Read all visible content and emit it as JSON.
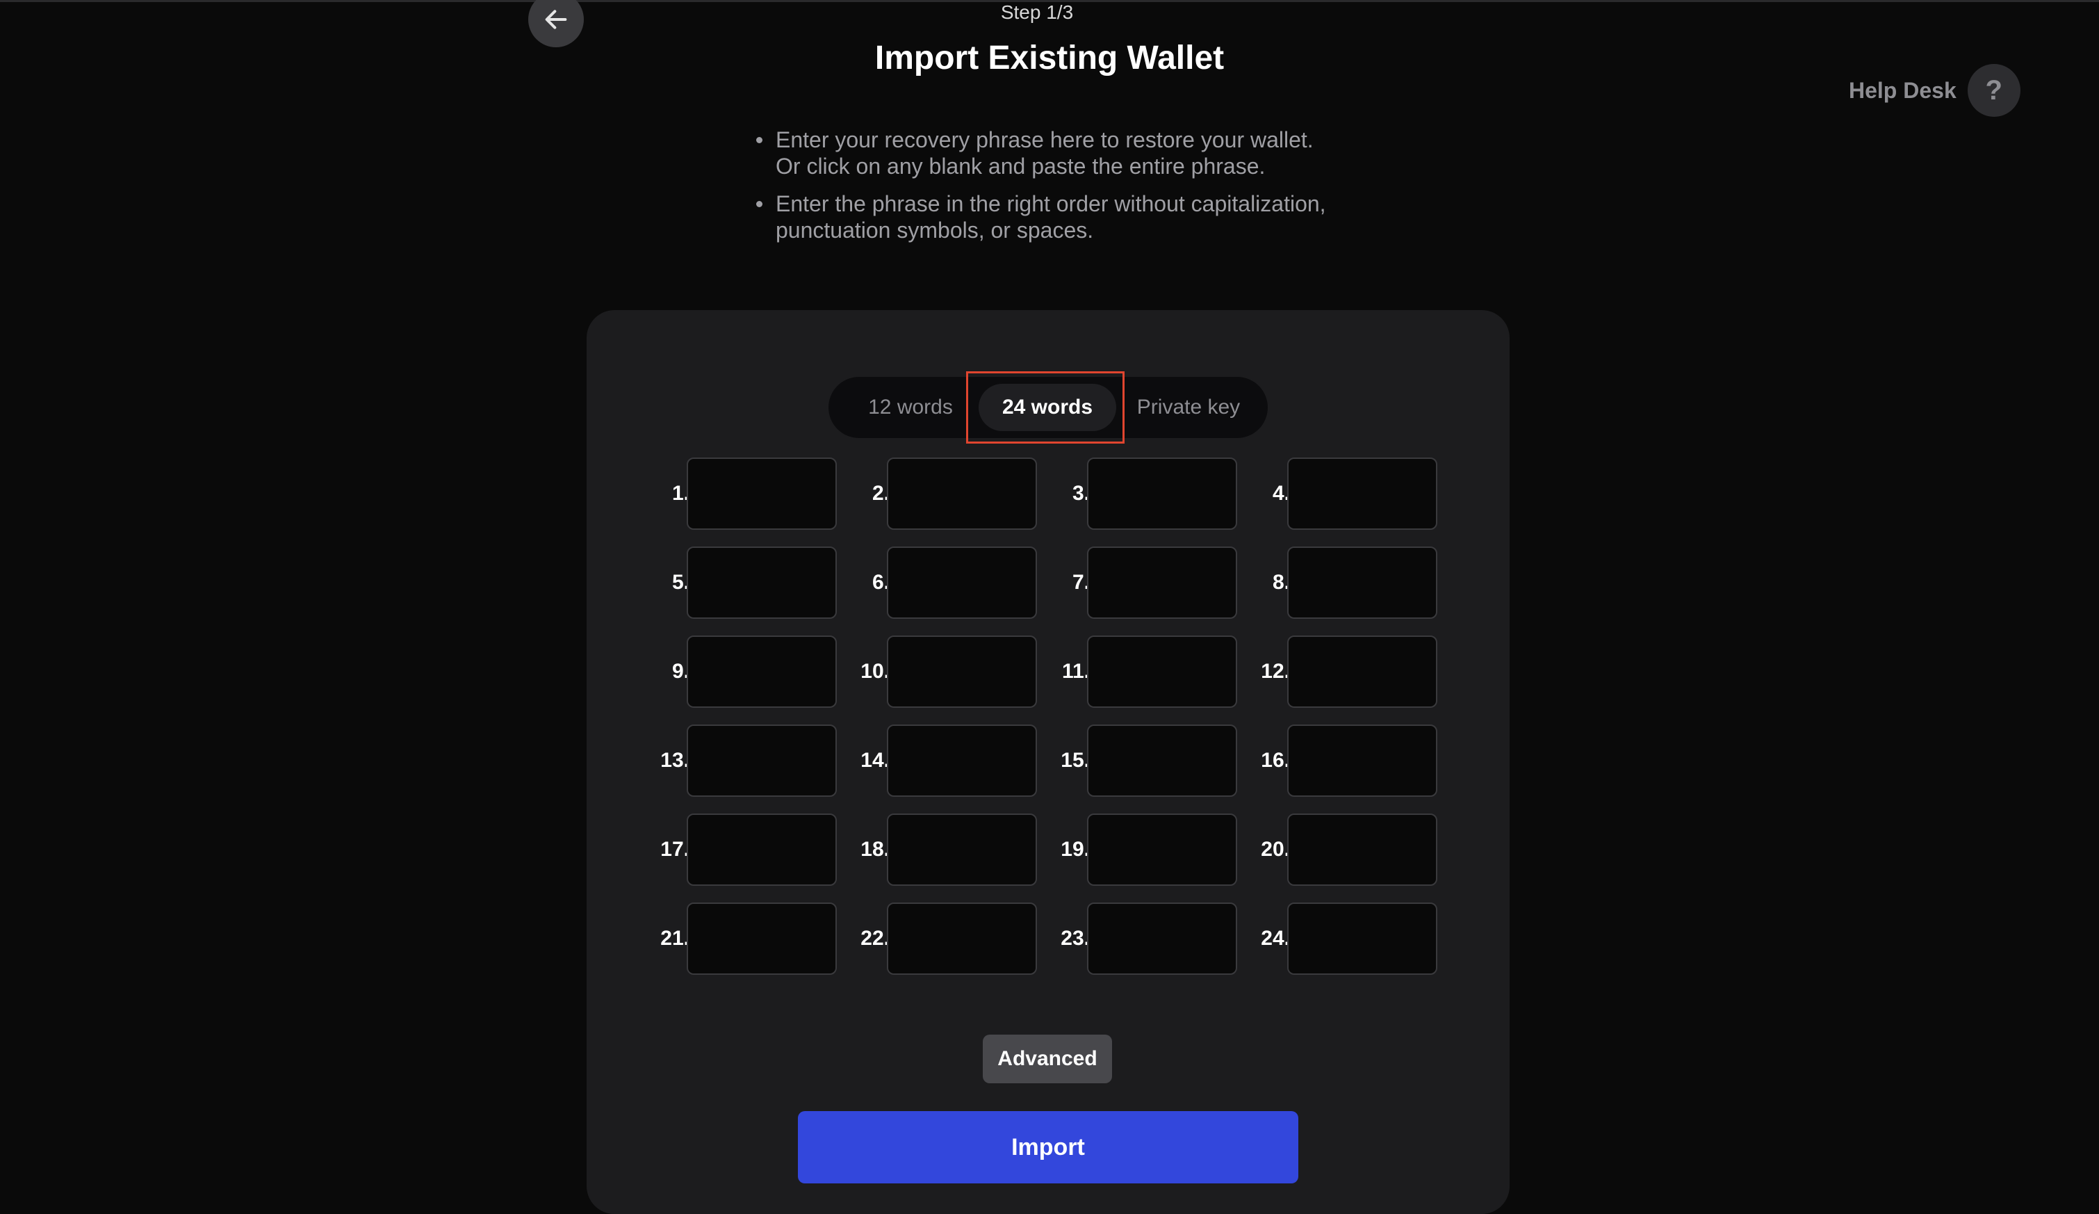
{
  "header": {
    "step": "Step 1/3",
    "title": "Import Existing Wallet",
    "back_icon": "arrow-left-icon"
  },
  "help": {
    "label": "Help Desk",
    "icon": "question-icon",
    "icon_glyph": "?"
  },
  "instructions": [
    {
      "line1": "Enter your recovery phrase here to restore your wallet.",
      "line2": "Or click on any blank and paste the entire phrase."
    },
    {
      "line1": "Enter the phrase in the right order without capitalization,",
      "line2": "punctuation symbols, or spaces."
    }
  ],
  "mode_tabs": {
    "tabs": [
      "12 words",
      "24 words",
      "Private key"
    ],
    "selected": "24 words"
  },
  "words": {
    "labels": [
      "1.",
      "2.",
      "3.",
      "4.",
      "5.",
      "6.",
      "7.",
      "8.",
      "9.",
      "10.",
      "11.",
      "12.",
      "13.",
      "14.",
      "15.",
      "16.",
      "17.",
      "18.",
      "19.",
      "20.",
      "21.",
      "22.",
      "23.",
      "24."
    ],
    "values": [
      "",
      "",
      "",
      "",
      "",
      "",
      "",
      "",
      "",
      "",
      "",
      "",
      "",
      "",
      "",
      "",
      "",
      "",
      "",
      "",
      "",
      "",
      "",
      ""
    ]
  },
  "buttons": {
    "advanced": "Advanced",
    "import": "Import"
  },
  "colors": {
    "background": "#0a0a0a",
    "card": "#1c1c1e",
    "primary": "#3347dc",
    "highlight": "#e0452f"
  }
}
